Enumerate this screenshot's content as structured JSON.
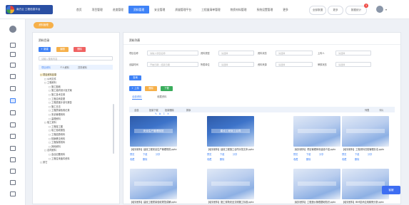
{
  "brand": {
    "name": "南方云 工程信息平台"
  },
  "nav": {
    "items": [
      "首页",
      "项目管理",
      "进度管理",
      "资料管理",
      "安全管理",
      "质量管理平台",
      "工程量清单管理",
      "物资材料管理",
      "系统设置管理",
      "更多"
    ],
    "active_index": 3
  },
  "topbar": {
    "btn1": "全部数据",
    "btn2": "更多",
    "btn3": "数据统计",
    "notification_count": "3"
  },
  "breadcrumb": {
    "label": "资料管理"
  },
  "left_panel": {
    "title": "资料目录",
    "buttons": [
      "+ 新建",
      "编辑",
      "删除"
    ],
    "search_placeholder": "请输入搜索内容",
    "tabs": [
      "项目资料",
      "个人资料",
      "共享资料"
    ],
    "tree": [
      {
        "label": "□ 项目资料目录",
        "level": 0,
        "hl": true
      },
      {
        "label": "□ 公司文件",
        "level": 1
      },
      {
        "label": "□ 工程资料",
        "level": 1
      },
      {
        "label": "□ 施工图纸",
        "level": 2
      },
      {
        "label": "□ 施工组织设计及方案",
        "level": 2
      },
      {
        "label": "□ 施工技术交底",
        "level": 2
      },
      {
        "label": "□ 工程洽商变更",
        "level": 2
      },
      {
        "label": "□ 工程进度计划与报告",
        "level": 2
      },
      {
        "label": "□ 施工日志",
        "level": 2
      },
      {
        "label": "□ 工程质量验收记录",
        "level": 2
      },
      {
        "label": "□ 安全管理资料",
        "level": 2
      },
      {
        "label": "□ 监理资料",
        "level": 2
      },
      {
        "label": "□ 竣工资料",
        "level": 1
      },
      {
        "label": "□ 工程竣工图",
        "level": 2
      },
      {
        "label": "□ 竣工验收报告",
        "level": 2
      },
      {
        "label": "□ 工程结算资料",
        "level": 2
      },
      {
        "label": "□ 档案移交资料",
        "level": 2
      },
      {
        "label": "□ 工程保修资料",
        "level": 2
      },
      {
        "label": "□ 其他资料",
        "level": 2
      },
      {
        "label": "□ 合同资料",
        "level": 1
      },
      {
        "label": "□ 会议纪要资料",
        "level": 2
      },
      {
        "label": "□ 工程往来函件资料",
        "level": 2
      },
      {
        "label": "□ 其它",
        "level": 0
      }
    ]
  },
  "right_panel": {
    "title": "资料列表",
    "filters": [
      {
        "label": "项目名称",
        "placeholder": "请输入项目名称"
      },
      {
        "label": "资料类型",
        "placeholder": "请选择"
      },
      {
        "label": "资料状态",
        "placeholder": "请选择"
      },
      {
        "label": "上传人",
        "placeholder": "请选择"
      },
      {
        "label": "创建时间",
        "placeholder": "开始日期 - 结束日期"
      },
      {
        "label": "所属单位",
        "placeholder": "请选择"
      },
      {
        "label": "资料来源",
        "placeholder": "请选择"
      },
      {
        "label": "审核状态",
        "placeholder": "请选择"
      }
    ],
    "search_btn": "查询",
    "action_btns": [
      "+ 上传",
      "删除",
      "下载"
    ],
    "tabs": [
      "全部资料",
      "收藏资料"
    ],
    "toolbar_text": [
      "全选",
      "批量下载",
      "批量删除",
      "排序"
    ],
    "view_labels": [
      "列表",
      "卡片"
    ],
    "cards": [
      {
        "title": "【培训资料】建设工程安全生产管理规范.pptx",
        "thumb": "安全生产管理规范",
        "actions": [
          "预览",
          "下载",
          "分享",
          "收藏",
          "删除"
        ]
      },
      {
        "title": "【培训资料】建设工程施工合同示范文本.pptx",
        "thumb": "建设工程施工合同",
        "actions": [
          "预览",
          "下载",
          "分享",
          "收藏",
          "删除"
        ]
      },
      {
        "title": "【培训资料】项目管理体系建设介绍.pptx",
        "thumb": "",
        "actions": [
          "预览",
          "下载",
          "分享",
          "收藏",
          "删除"
        ]
      },
      {
        "title": "【培训资料】工程资料归档管理办法.pptx",
        "thumb": "",
        "actions": [
          "预览",
          "下载",
          "分享",
          "收藏",
          "删除"
        ]
      },
      {
        "title": "【培训资料】建设工程质量验收规范讲解.pptx",
        "thumb": "",
        "actions": []
      },
      {
        "title": "【培训资料】施工现场安全文明施工标准.pptx",
        "thumb": "",
        "actions": []
      },
      {
        "title": "【培训资料】工程造价管理基础知识.pptx",
        "thumb": "",
        "actions": []
      },
      {
        "title": "【培训资料】BIM技术应用案例分析.pptx",
        "thumb": "",
        "actions": []
      }
    ]
  },
  "float_button": {
    "label": "客服"
  }
}
